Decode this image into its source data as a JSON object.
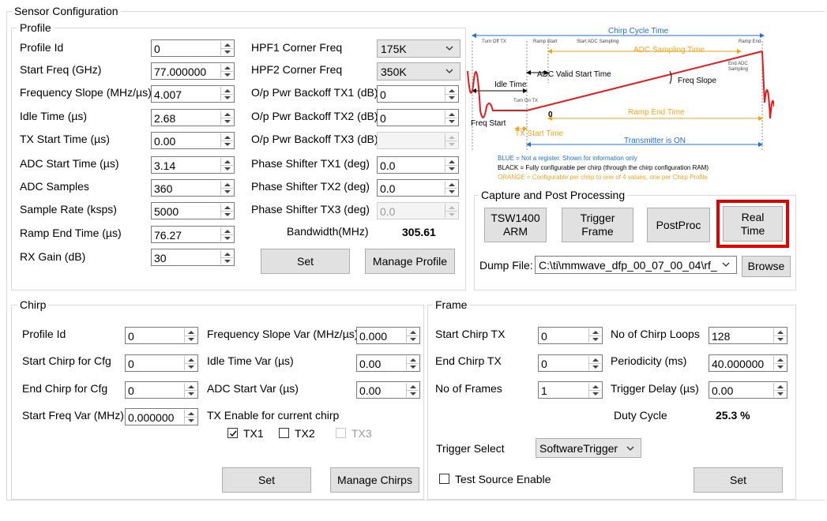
{
  "window": {
    "title": "Sensor Configuration"
  },
  "profile": {
    "title": "Profile",
    "left_fields": [
      {
        "label": "Profile Id",
        "value": "0"
      },
      {
        "label": "Start Freq (GHz)",
        "value": "77.000000"
      },
      {
        "label": "Frequency Slope (MHz/µs)",
        "value": "4.007"
      },
      {
        "label": "Idle Time (µs)",
        "value": "2.68"
      },
      {
        "label": "TX Start Time (µs)",
        "value": "0.00"
      },
      {
        "label": "ADC Start Time (µs)",
        "value": "3.14"
      },
      {
        "label": "ADC Samples",
        "value": "360"
      },
      {
        "label": "Sample Rate (ksps)",
        "value": "5000"
      },
      {
        "label": "Ramp End Time (µs)",
        "value": "76.27"
      },
      {
        "label": "RX Gain (dB)",
        "value": "30"
      }
    ],
    "hpf1": {
      "label": "HPF1 Corner Freq",
      "value": "175K"
    },
    "hpf2": {
      "label": "HPF2 Corner Freq",
      "value": "350K"
    },
    "right_fields": [
      {
        "label": "O/p Pwr Backoff TX1 (dB)",
        "value": "0"
      },
      {
        "label": "O/p Pwr Backoff TX2 (dB)",
        "value": "0"
      },
      {
        "label": "O/p Pwr Backoff TX3 (dB)",
        "value": ""
      },
      {
        "label": "Phase Shifter TX1 (deg)",
        "value": "0.0"
      },
      {
        "label": "Phase Shifter TX2 (deg)",
        "value": "0.0"
      },
      {
        "label": "Phase Shifter TX3 (deg)",
        "value": "0.0"
      }
    ],
    "bandwidth_label": "Bandwidth(MHz)",
    "bandwidth_value": "305.61",
    "set_label": "Set",
    "manage_label": "Manage Profile"
  },
  "diagram": {
    "chirp_cycle_time": "Chirp Cycle Time",
    "turn_off_tx": "Turn Off TX",
    "ramp_start": "Ramp Start",
    "start_adc_sampling": "Start ADC Sampling",
    "ramp_end": "Ramp End",
    "adc_sampling_time": "ADC Sampling Time",
    "end_adc_1": "End ADC",
    "end_adc_2": "Sampling",
    "adc_valid_start_time": "ADC Valid Start Time",
    "idle_time": "Idle Time",
    "freq_slope": "Freq Slope",
    "turn_on_tx": "Turn On TX",
    "zero": "0",
    "ramp_end_time": "Ramp End Time",
    "freq_start": "Freq Start",
    "tx_start_time": "TX Start Time",
    "transmitter_on": "Transmitter is ON",
    "legend_blue": "BLUE = Not a register. Shown for information only",
    "legend_black": "BLACK = Fully configurable per chirp (through the chirp configuration RAM)",
    "legend_orange": "ORANGE = Configurable per chirp to one of 4 values, one per Chirp Profile",
    "colors": {
      "blue": "#1f6fd1",
      "orange": "#f5a31a",
      "red": "#e31b1b"
    }
  },
  "capture": {
    "title": "Capture and Post Processing",
    "btn_tsw1": "TSW1400",
    "btn_tsw2": "ARM",
    "btn_trig1": "Trigger",
    "btn_trig2": "Frame",
    "btn_post": "PostProc",
    "btn_real1": "Real",
    "btn_real2": "Time",
    "dump_label": "Dump File:",
    "dump_value": "C:\\ti\\mmwave_dfp_00_07_00_04\\rf_",
    "browse": "Browse",
    "highlight_color": "#e00000"
  },
  "chirp": {
    "title": "Chirp",
    "left_fields": [
      {
        "label": "Profile Id",
        "value": "0"
      },
      {
        "label": "Start Chirp for Cfg",
        "value": "0"
      },
      {
        "label": "End Chirp for Cfg",
        "value": "0"
      },
      {
        "label": "Start Freq Var (MHz)",
        "value": "0.000000"
      }
    ],
    "right_fields": [
      {
        "label": "Frequency Slope Var (MHz/µs)",
        "value": "0.000"
      },
      {
        "label": "Idle Time Var (µs)",
        "value": "0.00"
      },
      {
        "label": "ADC Start Var (µs)",
        "value": "0.00"
      }
    ],
    "tx_enable_label": "TX Enable for current chirp",
    "tx1": "TX1",
    "tx2": "TX2",
    "tx3": "TX3",
    "set_label": "Set",
    "manage_label": "Manage Chirps"
  },
  "frame": {
    "title": "Frame",
    "left_fields": [
      {
        "label": "Start Chirp TX",
        "value": "0"
      },
      {
        "label": "End Chirp TX",
        "value": "0"
      },
      {
        "label": "No of Frames",
        "value": "1"
      }
    ],
    "right_fields": [
      {
        "label": "No of Chirp Loops",
        "value": "128"
      },
      {
        "label": "Periodicity (ms)",
        "value": "40.000000"
      },
      {
        "label": "Trigger Delay (µs)",
        "value": "0.00"
      }
    ],
    "duty_label": "Duty Cycle",
    "duty_value": "25.3 %",
    "trigger_label": "Trigger Select",
    "trigger_value": "SoftwareTrigger",
    "test_source": "Test Source Enable",
    "set_label": "Set"
  }
}
